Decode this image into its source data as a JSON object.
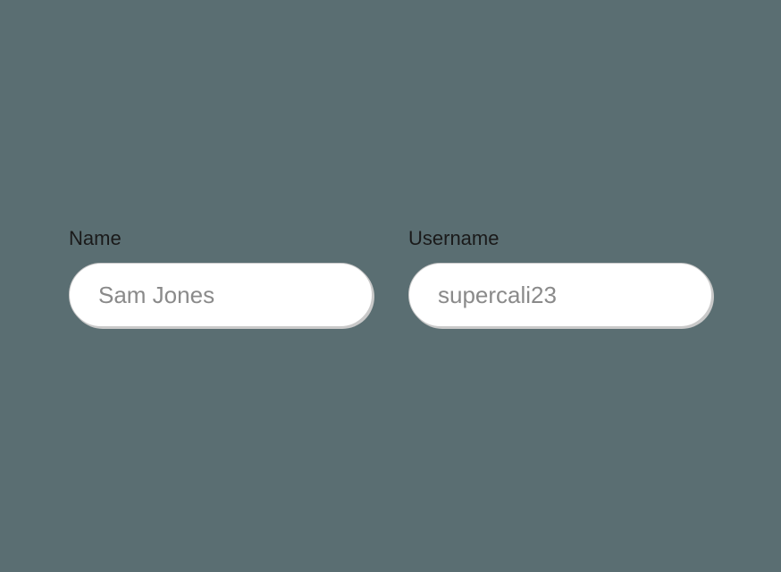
{
  "form": {
    "name": {
      "label": "Name",
      "placeholder": "Sam Jones",
      "value": ""
    },
    "username": {
      "label": "Username",
      "placeholder": "supercali23",
      "value": ""
    }
  }
}
